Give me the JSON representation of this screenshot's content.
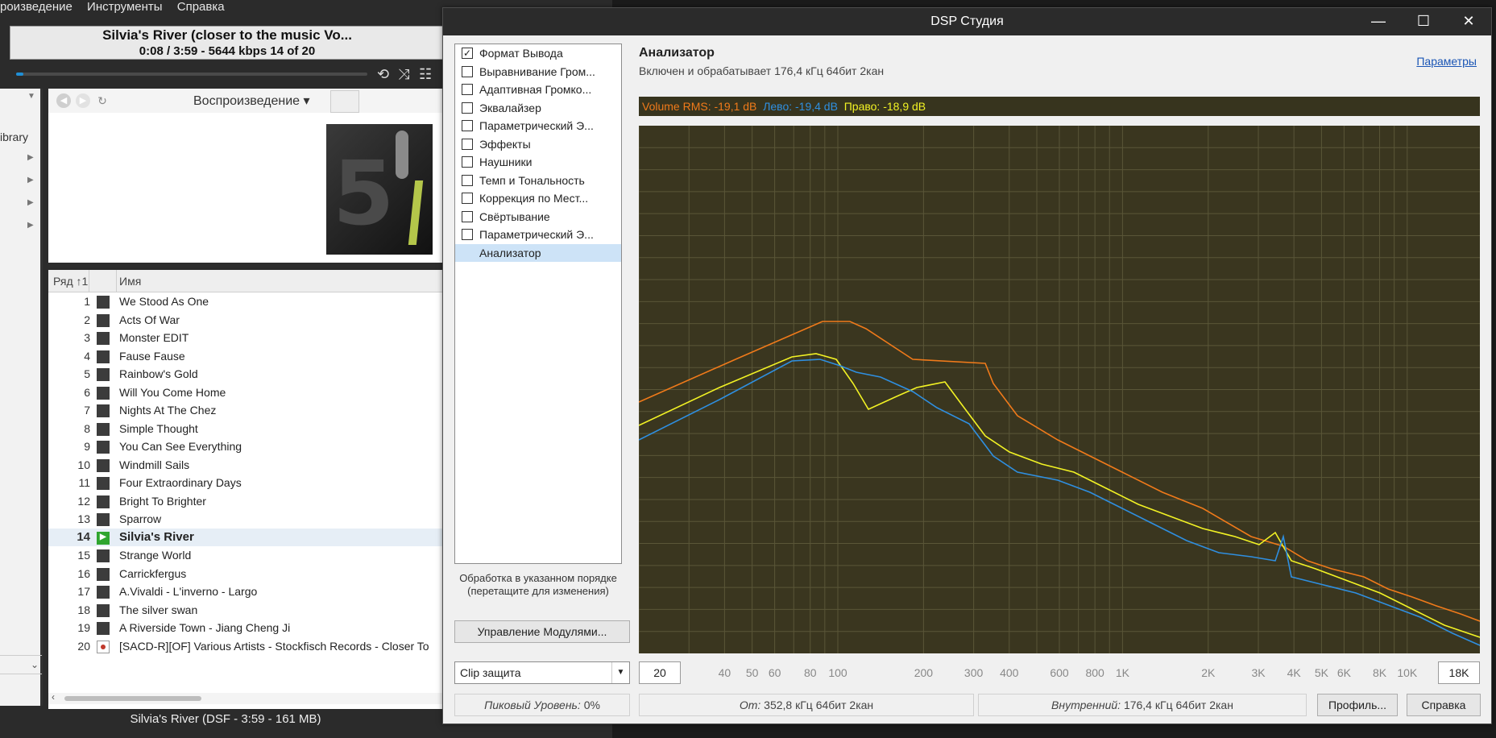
{
  "player": {
    "menu": [
      "роизведение",
      "Инструменты",
      "Справка"
    ],
    "now_playing_title": "Silvia's River (closer to the music Vo...",
    "now_playing_sub": "0:08 / 3:59 - 5644 kbps  14 of 20",
    "progress": 0.02,
    "library_label": "ibrary",
    "view_tab": "Воспроизведение ▾",
    "playlist_headers": [
      "Ряд ↑1",
      "Имя"
    ],
    "tracks": [
      {
        "n": "1",
        "title": "We Stood As One"
      },
      {
        "n": "2",
        "title": "Acts Of War"
      },
      {
        "n": "3",
        "title": "Monster EDIT"
      },
      {
        "n": "4",
        "title": "Fause Fause"
      },
      {
        "n": "5",
        "title": "Rainbow's Gold"
      },
      {
        "n": "6",
        "title": "Will You Come Home"
      },
      {
        "n": "7",
        "title": "Nights At The Chez"
      },
      {
        "n": "8",
        "title": "Simple Thought"
      },
      {
        "n": "9",
        "title": "You Can See Everything"
      },
      {
        "n": "10",
        "title": "Windmill Sails"
      },
      {
        "n": "11",
        "title": "Four Extraordinary Days"
      },
      {
        "n": "12",
        "title": "Bright To Brighter"
      },
      {
        "n": "13",
        "title": "Sparrow"
      },
      {
        "n": "14",
        "title": "Silvia's River",
        "playing": true
      },
      {
        "n": "15",
        "title": "Strange World"
      },
      {
        "n": "16",
        "title": "Carrickfergus"
      },
      {
        "n": "17",
        "title": "A.Vivaldi - L'inverno - Largo"
      },
      {
        "n": "18",
        "title": "The silver swan"
      },
      {
        "n": "19",
        "title": "A Riverside Town - Jiang Cheng Ji"
      },
      {
        "n": "20",
        "title": "[SACD-R][OF] Various Artists - Stockfisch Records - Closer To",
        "sacd": true
      }
    ],
    "status": "Silvia's River (DSF - 3:59 - 161 MB)"
  },
  "dsp": {
    "title": "DSP Студия",
    "modules": [
      {
        "label": "Формат Вывода",
        "checked": true
      },
      {
        "label": "Выравнивание Гром...",
        "checked": false
      },
      {
        "label": "Адаптивная Громко...",
        "checked": false
      },
      {
        "label": "Эквалайзер",
        "checked": false
      },
      {
        "label": "Параметрический Э...",
        "checked": false
      },
      {
        "label": "Эффекты",
        "checked": false
      },
      {
        "label": "Наушники",
        "checked": false
      },
      {
        "label": "Темп и Тональность",
        "checked": false
      },
      {
        "label": "Коррекция по Мест...",
        "checked": false
      },
      {
        "label": "Свёртывание",
        "checked": false
      },
      {
        "label": "Параметрический Э...",
        "checked": false
      },
      {
        "label": "Анализатор",
        "selected": true
      }
    ],
    "order_note": "Обработка в указанном порядке (перетащите для изменения)",
    "manage_button": "Управление Модулями...",
    "clip_value": "Clip защита",
    "peak_label": "Пиковый Уровень:",
    "peak_value": "0%",
    "from_label": "От:",
    "from_value": "352,8 кГц 64бит 2кан",
    "internal_label": "Внутренний:",
    "internal_value": "176,4 кГц 64бит 2кан",
    "profile_button": "Профиль...",
    "help_button": "Справка",
    "analyzer": {
      "title": "Анализатор",
      "subtitle": "Включен и обрабатывает 176,4 кГц 64бит 2кан",
      "params_link": "Параметры",
      "volume_rms": "Volume RMS: -19,1 dB",
      "left_level": "Лево: -19,4 dB",
      "right_level": "Право: -18,9 dB",
      "freq_min": "20",
      "freq_max": "18K",
      "freq_ticks": [
        "40",
        "50",
        "60",
        "80",
        "100",
        "200",
        "300",
        "400",
        "600",
        "800",
        "1K",
        "2K",
        "3K",
        "4K",
        "5K",
        "6K",
        "8K",
        "10K"
      ]
    },
    "colors": {
      "rms": "#f07a1a",
      "left": "#2f8fe0",
      "right": "#f2f224",
      "chart_bg": "#3a361f",
      "grid": "#5a5638"
    }
  }
}
